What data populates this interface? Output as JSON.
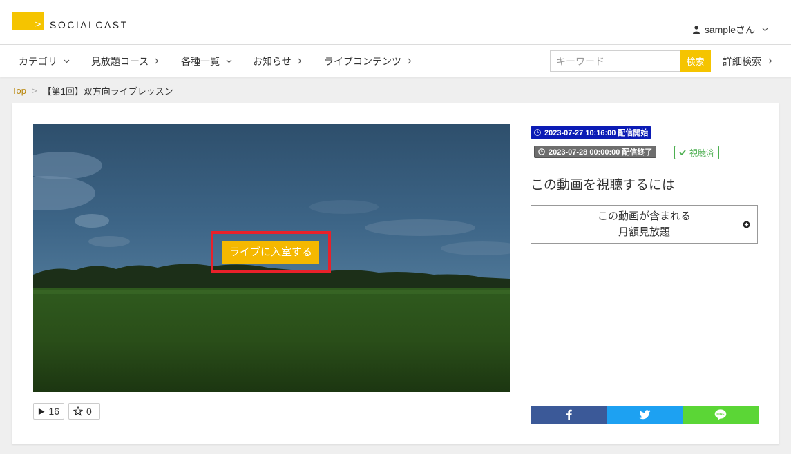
{
  "header": {
    "logo_text": "SOCIALCAST",
    "logo_arrow": ">",
    "user_name": "sampleさん"
  },
  "nav": {
    "items": [
      {
        "label": "カテゴリ",
        "caret": "chevron-down"
      },
      {
        "label": "見放題コース",
        "caret": "chevron-right"
      },
      {
        "label": "各種一覧",
        "caret": "chevron-down"
      },
      {
        "label": "お知らせ",
        "caret": "chevron-right"
      },
      {
        "label": "ライブコンテンツ",
        "caret": "chevron-right"
      }
    ],
    "search_placeholder": "キーワード",
    "search_button": "検索",
    "advanced_search": "詳細検索"
  },
  "breadcrumb": {
    "home": "Top",
    "separator": ">",
    "current": "【第1回】双方向ライブレッスン"
  },
  "video": {
    "enter_button": "ライブに入室する",
    "play_count": "16",
    "favorite_count": "0"
  },
  "info": {
    "start_badge": "2023-07-27 10:16:00 配信開始",
    "end_badge": "2023-07-28 00:00:00 配信終了",
    "watched_badge": "視聴済",
    "watch_title": "この動画を視聴するには",
    "plan_line1": "この動画が含まれる",
    "plan_line2": "月額見放題"
  },
  "colors": {
    "accent": "#f5c400",
    "start_badge": "#0b1bb5",
    "end_badge": "#6e6e6e",
    "watched": "#4caf50",
    "highlight_border": "#e8212a",
    "facebook": "#3b5998",
    "twitter": "#1da1f2",
    "line": "#5bd636"
  }
}
